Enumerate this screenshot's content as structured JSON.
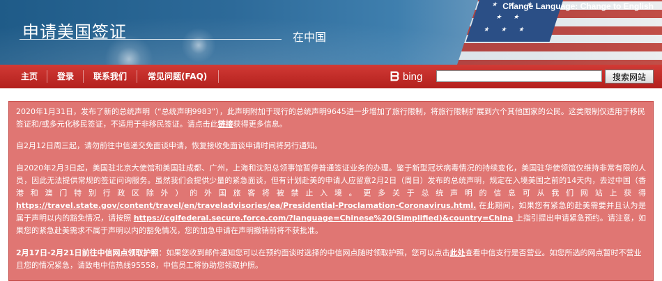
{
  "header": {
    "title": "申请美国签证",
    "subtitle": "在中国",
    "change_language_prefix": "Change Language:",
    "change_language_link": "Change to English"
  },
  "nav": {
    "items": [
      {
        "label": "主页"
      },
      {
        "label": "登录"
      },
      {
        "label": "联系我们"
      },
      {
        "label": "常见问题(FAQ)"
      }
    ]
  },
  "search": {
    "brand": "bing",
    "input_value": "",
    "placeholder": "",
    "button_label": "搜索网站"
  },
  "alert": {
    "p1_text1": "2020年1月31日，发布了新的总统声明（“总统声明9983”），此声明附加于现行的总统声明9645进一步增加了旅行限制，将旅行限制扩展到六个其他国家的公民。这类限制仅适用于移民签证和/或多元化移民签证，不适用于非移民签证。请点击此",
    "p1_link": "链接",
    "p1_text2": "获得更多信息。",
    "p2": "自2月12日周三起，请勿前往中信递交免面谈申请，恢复接收免面谈申请时间将另行通知。",
    "p3_text1": "自2020年2月3日起，美国驻北京大使馆和美国驻成都、广州，上海和沈阳总领事馆暂停普通签证业务的办理。鉴于新型冠状病毒情况的持续变化，美国驻华使领馆仅维持非常有限的人员，因此无法提供常规的签证问询服务。虽然我们会提供少量的紧急面谈，但有计划赴美的申请人应留意2月2日（周日）发布的总统声明，规定在入境美国之前的14天内，去过中国（香港和澳门特别行政区除外）的外国旅客将被禁止入境。更多关于总统声明的信息可从我们网站上获得",
    "p3_link1": "https://travel.state.gov/content/travel/en/traveladvisories/ea/Presidential-Proclamation-Coronavirus.html.",
    "p3_text2": " 在此期间，如果您有紧急的赴美需要并且认为是属于声明以内的豁免情况，请按照 ",
    "p3_link2": "https://cgifederal.secure.force.com/?language=Chinese%20(Simplified)&country=China",
    "p3_text3": " 上指引提出申请紧急预约。请注意，如果您的紧急赴美需求不属于声明以内的豁免情况，您的加急申请在声明撤销前将不获批准。",
    "p4_bold": "2月17日-2月21日前往中信网点领取护照",
    "p4_text1": "：如果您收到邮件通知您可以在预约面谈时选择的中信网点随时领取护照，您可以点击",
    "p4_link": "此处",
    "p4_text2": "查看中信支行是否营业。如您所选的网点暂时不营业且您的情况紧急，请致电中信热线95558，中信员工将协助您领取护照。"
  },
  "colors": {
    "nav_red": "#c0302b",
    "alert_bg": "#e07673"
  },
  "icons": {
    "bing_logo": "bing-logo-icon"
  }
}
